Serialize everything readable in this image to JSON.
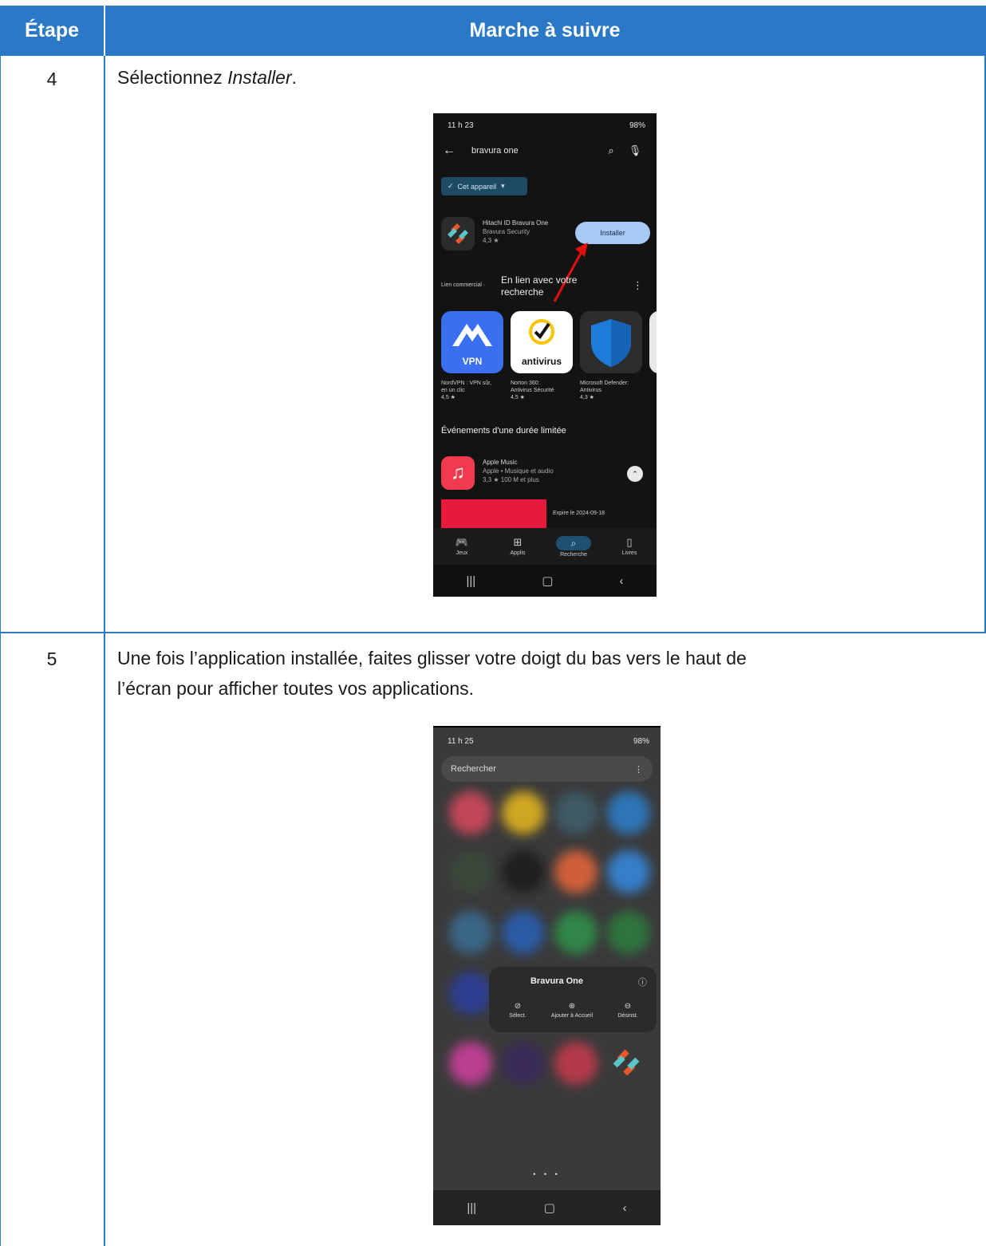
{
  "table": {
    "headers": {
      "step": "Étape",
      "instructions": "Marche à suivre"
    },
    "rows": [
      {
        "step": "4",
        "text_plain": "Sélectionnez ",
        "text_italic": "Installer",
        "text_end": "."
      },
      {
        "step": "5",
        "line1": "Une fois l’application installée, faites glisser votre doigt du bas vers le haut de",
        "line2": "l’écran pour afficher toutes vos applications."
      }
    ]
  },
  "colors": {
    "header": "#2a78c6",
    "install_button": "#a8c8f5",
    "play_store_bg": "#131313"
  },
  "screenshot1": {
    "status_time": "11 h 23",
    "status_right": "98%",
    "search_query": "bravura one",
    "chip": "Cet appareil",
    "app": {
      "name": "Hitachi ID Bravura One",
      "developer": "Bravura Security",
      "rating": "4,3 ★"
    },
    "install_label": "Installer",
    "sponsored_label": "Lien commercial ·",
    "sponsored_title_1": "En lien avec votre",
    "sponsored_title_2": "recherche",
    "tiles": [
      {
        "label": "VPN",
        "name1": "NordVPN : VPN sûr,",
        "name2": "en un clic",
        "rating": "4,5 ★"
      },
      {
        "label": "antivirus",
        "name1": "Norton 360:",
        "name2": "Antivirus Sécurité",
        "rating": "4,5 ★"
      },
      {
        "label": "",
        "name1": "Microsoft Defender:",
        "name2": "Antivirus",
        "rating": "4,3 ★"
      }
    ],
    "section_title": "Événements d'une durée limitée",
    "music": {
      "name": "Apple Music",
      "sub": "Apple • Musique et audio",
      "meta": "3,3 ★   100 M et plus"
    },
    "promo_date": "Expire le 2024-09-18",
    "nav": {
      "games": "Jeux",
      "apps": "Applis",
      "search": "Recherche",
      "books": "Livres"
    }
  },
  "screenshot2": {
    "status_time": "11 h 25",
    "status_right": "98%",
    "search_placeholder": "Rechercher",
    "context_title": "Bravura One",
    "actions": {
      "select": "Sélect.",
      "add_home": "Ajouter à Accueil",
      "uninstall": "Désinst."
    },
    "page_dots": "• • •"
  }
}
